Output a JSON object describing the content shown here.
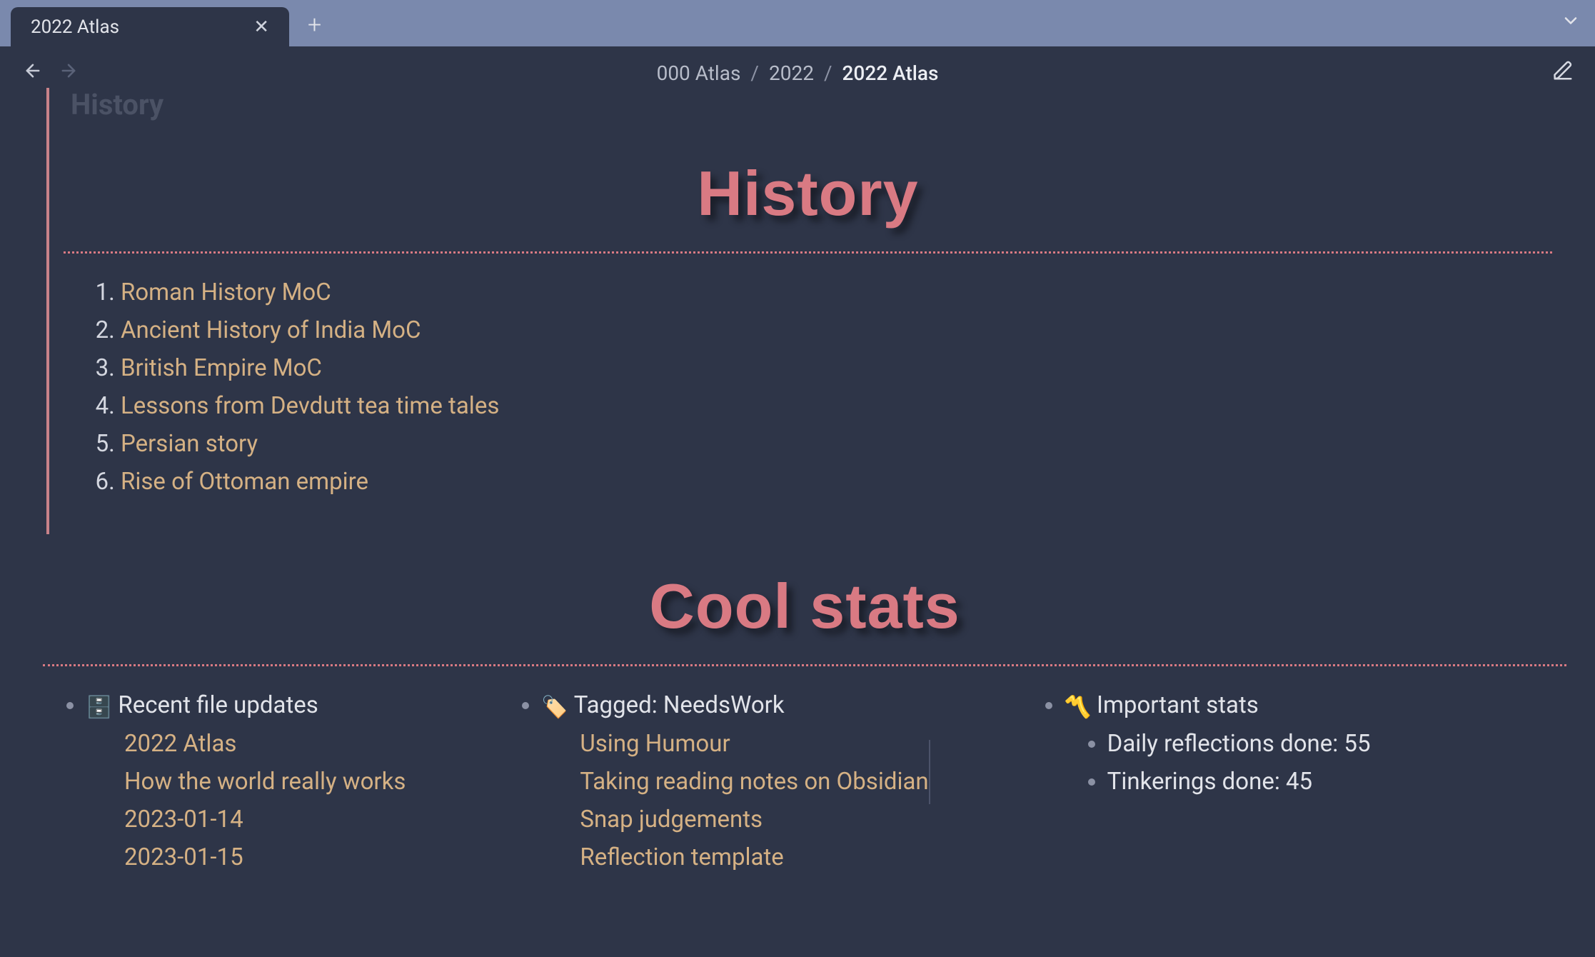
{
  "tab": {
    "title": "2022 Atlas"
  },
  "breadcrumb": {
    "part1": "000 Atlas",
    "part2": "2022",
    "current": "2022 Atlas"
  },
  "fadedLabel": "History",
  "history": {
    "heading": "History",
    "items": [
      "Roman History MoC",
      "Ancient History of India MoC",
      "British Empire MoC",
      "Lessons from Devdutt tea time tales",
      "Persian story",
      "Rise of Ottoman empire"
    ]
  },
  "coolstats": {
    "heading": "Cool stats",
    "recent": {
      "emoji": "🗄️",
      "label": "Recent file updates",
      "items": [
        "2022 Atlas",
        "How the world really works",
        "2023-01-14",
        "2023-01-15"
      ]
    },
    "tagged": {
      "emoji": "🏷️",
      "label": "Tagged: NeedsWork",
      "items": [
        "Using Humour",
        "Taking reading notes on Obsidian",
        "Snap judgements",
        "Reflection template"
      ]
    },
    "important": {
      "emoji": "〽️",
      "label": "Important stats",
      "items": [
        "Daily reflections done: 55",
        "Tinkerings done: 45"
      ]
    }
  }
}
